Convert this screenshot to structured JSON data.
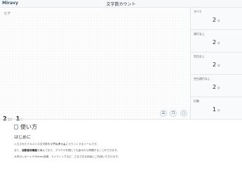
{
  "header": {
    "brand": "Miravy",
    "title": "文字数カウント"
  },
  "editor": {
    "text": "リア",
    "summary": {
      "chars": "2",
      "chars_unit": "文字",
      "lines": "1",
      "lines_unit": "行"
    }
  },
  "toolbar": {
    "buttons": [
      {
        "name": "list-icon",
        "glyph": "☰"
      },
      {
        "name": "copy-icon",
        "glyph": "❐"
      },
      {
        "name": "clipboard-icon",
        "glyph": "▢"
      }
    ]
  },
  "stats": [
    {
      "label": "すべて",
      "value": "2",
      "unit": "字"
    },
    {
      "label": "改行なし",
      "value": "2",
      "unit": "字"
    },
    {
      "label": "空白なし",
      "value": "2",
      "unit": "字"
    },
    {
      "label": "空白改行なし",
      "value": "2",
      "unit": "字"
    },
    {
      "label": "行数",
      "value": "1",
      "unit": "行"
    }
  ],
  "howto": {
    "title": "使い方",
    "intro_title": "はじめに",
    "p1_a": "入力されたテキストの文字数を",
    "p1_b": "リアルタイム",
    "p1_c": "にカウントするツールです。",
    "p2_a": "また、",
    "p2_b": "自動保存機能",
    "p2_c": "を備えており、ブラウザを閉じても途中から再開することができます。",
    "p3": "大学のレポートやTwitter投稿、ライティングなど、さまざまな用途にご利用いただけます。"
  }
}
